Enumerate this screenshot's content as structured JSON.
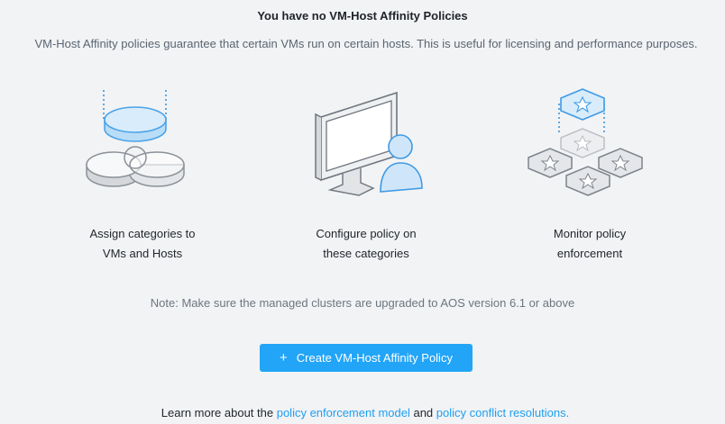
{
  "empty_state": {
    "title": "You have no VM-Host Affinity Policies",
    "description": "VM-Host Affinity policies guarantee that certain VMs run on certain hosts. This is useful for licensing and performance purposes."
  },
  "steps": [
    {
      "label": "Assign categories to\nVMs and Hosts",
      "icon": "categories-venn-icon"
    },
    {
      "label": "Configure policy on\nthese categories",
      "icon": "monitor-user-icon"
    },
    {
      "label": "Monitor policy\nenforcement",
      "icon": "shield-badges-icon"
    }
  ],
  "note": "Note: Make sure the managed clusters are upgraded to AOS version 6.1 or above",
  "create_button": {
    "icon": "+",
    "label": "Create VM-Host Affinity Policy"
  },
  "footer": {
    "prefix": "Learn more about the ",
    "link1": "policy enforcement model",
    "middle": " and ",
    "link2": "policy conflict resolutions",
    "suffix": "."
  },
  "colors": {
    "accent": "#22a5f7",
    "link": "#1f9ff0",
    "background": "#f2f3f5"
  }
}
